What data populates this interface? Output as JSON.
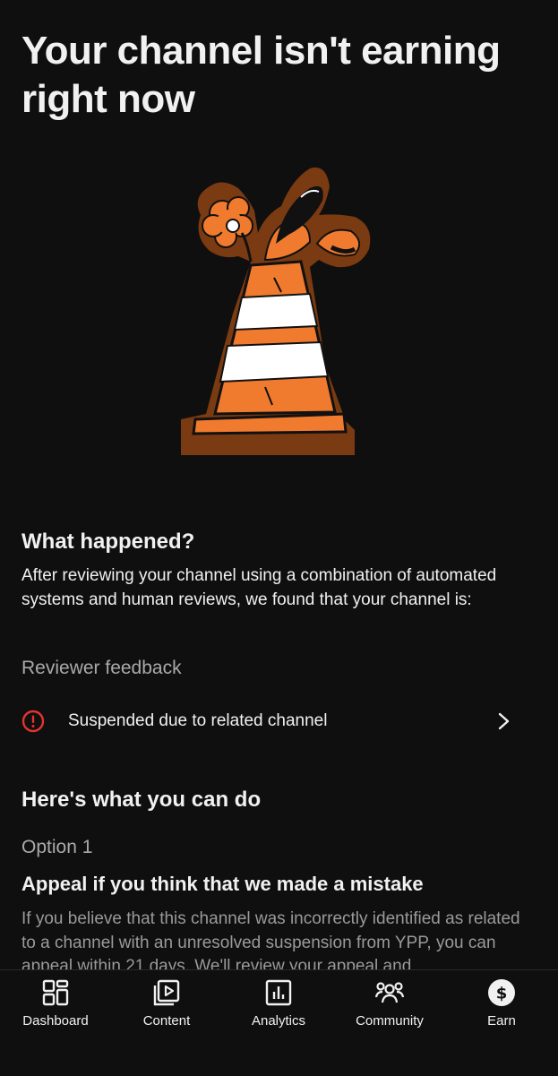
{
  "page": {
    "title": "Your channel isn't earning right now"
  },
  "what_happened": {
    "heading": "What happened?",
    "body": "After reviewing your channel using a combination of automated systems and human reviews, we found that your channel is:",
    "reviewer_label": "Reviewer feedback",
    "feedback_item": "Suspended due to related channel"
  },
  "what_you_can_do": {
    "heading": "Here's what you can do",
    "option_label": "Option 1",
    "option_title": "Appeal if you think that we made a mistake",
    "option_body": "If you believe that this channel was incorrectly identified as related to a channel with an unresolved suspension from YPP, you can appeal within 21 days. We'll review your appeal and"
  },
  "bottom_nav": {
    "items": [
      {
        "label": "Dashboard",
        "icon": "dashboard-icon"
      },
      {
        "label": "Content",
        "icon": "content-icon"
      },
      {
        "label": "Analytics",
        "icon": "analytics-icon"
      },
      {
        "label": "Community",
        "icon": "community-icon"
      },
      {
        "label": "Earn",
        "icon": "earn-icon"
      }
    ]
  },
  "colors": {
    "background": "#0f0f0f",
    "text": "#f1f1f1",
    "muted": "#aaaaaa",
    "warning": "#e3342f",
    "cone_orange": "#f07a2e",
    "cone_outline_brown": "#7a3a12"
  }
}
